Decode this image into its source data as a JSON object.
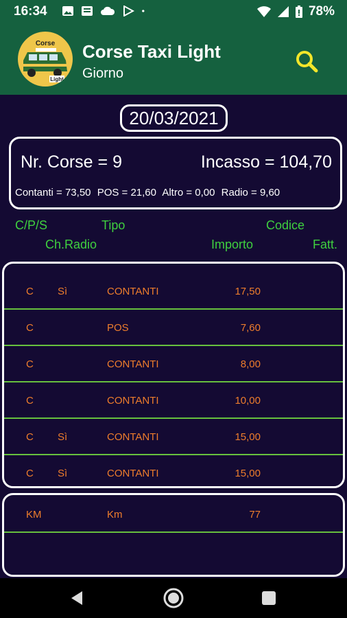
{
  "status_bar": {
    "time": "16:34",
    "battery": "78%",
    "icons": [
      "image-icon",
      "message-icon",
      "cloud-icon",
      "play-icon",
      "dot-icon",
      "wifi-icon",
      "signal-icon",
      "battery-icon"
    ]
  },
  "app_bar": {
    "title": "Corse Taxi Light",
    "subtitle": "Giorno",
    "logo_icon": "taxi-logo-icon",
    "logo_text_top": "Corse",
    "logo_text_bottom": "Light",
    "search_icon": "search-icon"
  },
  "date": "20/03/2021",
  "summary": {
    "nr_corse": "Nr. Corse = 9",
    "incasso": "Incasso = 104,70",
    "contanti": "Contanti = 73,50",
    "pos": "POS = 21,60",
    "altro": "Altro = 0,00",
    "radio": "Radio = 9,60"
  },
  "headers": {
    "cps": "C/P/S",
    "tipo": "Tipo",
    "codice": "Codice",
    "ch_radio": "Ch.Radio",
    "importo": "Importo",
    "fatt": "Fatt."
  },
  "rows": [
    {
      "cps": "C",
      "radio": "Sì",
      "tipo": "CONTANTI",
      "importo": "17,50"
    },
    {
      "cps": "C",
      "radio": "",
      "tipo": "POS",
      "importo": "7,60"
    },
    {
      "cps": "C",
      "radio": "",
      "tipo": "CONTANTI",
      "importo": "8,00"
    },
    {
      "cps": "C",
      "radio": "",
      "tipo": "CONTANTI",
      "importo": "10,00"
    },
    {
      "cps": "C",
      "radio": "Sì",
      "tipo": "CONTANTI",
      "importo": "15,00"
    },
    {
      "cps": "C",
      "radio": "Sì",
      "tipo": "CONTANTI",
      "importo": "15,00"
    }
  ],
  "km_row": {
    "col1": "KM",
    "col2": "Km",
    "value": "77"
  },
  "colors": {
    "background": "#140a33",
    "app_bar": "#15613f",
    "header_green": "#3fd03f",
    "row_text_orange": "#ee7d2c",
    "divider_green": "#67c13e",
    "search_yellow": "#f2e62a",
    "logo_yellow": "#efc64a"
  },
  "nav_icons": [
    "back-icon",
    "home-icon",
    "recents-icon"
  ]
}
